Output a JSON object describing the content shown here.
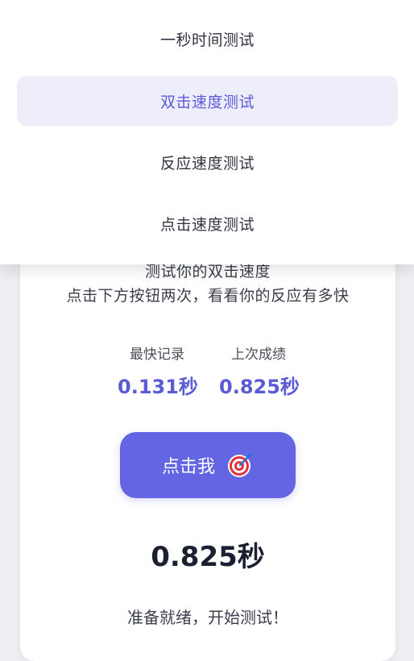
{
  "menu": {
    "items": [
      {
        "label": "一秒时间测试",
        "active": false
      },
      {
        "label": "双击速度测试",
        "active": true
      },
      {
        "label": "反应速度测试",
        "active": false
      },
      {
        "label": "点击速度测试",
        "active": false
      }
    ]
  },
  "card": {
    "subtitle_partial": "测试你的双击速度",
    "instruction": "点击下方按钮两次，看看你的反应有多快"
  },
  "stats": {
    "best_label": "最快记录",
    "best_value": "0.131秒",
    "last_label": "上次成绩",
    "last_value": "0.825秒"
  },
  "tap_button": {
    "label": "点击我",
    "icon": "target-icon"
  },
  "result": {
    "value": "0.825秒"
  },
  "status": {
    "text": "准备就绪，开始测试！"
  },
  "colors": {
    "accent": "#6365e3",
    "accent_text": "#5b5bd6",
    "active_bg": "#eeeefb",
    "page_bg": "#eeeef3"
  }
}
